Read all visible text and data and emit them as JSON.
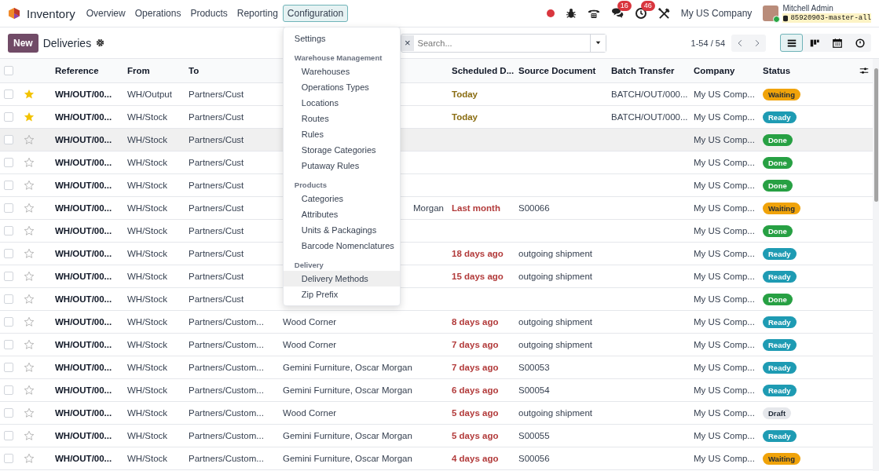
{
  "navbar": {
    "app_name": "Inventory",
    "menu": [
      {
        "label": "Overview",
        "selected": false
      },
      {
        "label": "Operations",
        "selected": false
      },
      {
        "label": "Products",
        "selected": false
      },
      {
        "label": "Reporting",
        "selected": false
      },
      {
        "label": "Configuration",
        "selected": true
      }
    ],
    "systray": {
      "chat_count": "16",
      "activity_count": "46",
      "company": "My US Company",
      "user_name": "Mitchell Admin",
      "database": "85920903-master-all"
    }
  },
  "control_panel": {
    "new_label": "New",
    "title": "Deliveries",
    "search": {
      "facet_remove": "×",
      "placeholder": "Search..."
    },
    "pager": "1-54 / 54",
    "views": [
      {
        "kind": "list",
        "selected": true
      },
      {
        "kind": "kanban",
        "selected": false
      },
      {
        "kind": "calendar",
        "selected": false
      },
      {
        "kind": "activity",
        "selected": false
      }
    ]
  },
  "configuration_menu": {
    "entries": [
      {
        "kind": "item",
        "label": "Settings",
        "highlighted": false
      },
      {
        "kind": "section",
        "label": "Warehouse Management",
        "children": [
          {
            "label": "Warehouses",
            "highlighted": false
          },
          {
            "label": "Operations Types",
            "highlighted": false
          },
          {
            "label": "Locations",
            "highlighted": false
          },
          {
            "label": "Routes",
            "highlighted": false
          },
          {
            "label": "Rules",
            "highlighted": false
          },
          {
            "label": "Storage Categories",
            "highlighted": false
          },
          {
            "label": "Putaway Rules",
            "highlighted": false
          }
        ]
      },
      {
        "kind": "section",
        "label": "Products",
        "children": [
          {
            "label": "Categories",
            "highlighted": false
          },
          {
            "label": "Attributes",
            "highlighted": false
          },
          {
            "label": "Units & Packagings",
            "highlighted": false
          },
          {
            "label": "Barcode Nomenclatures",
            "highlighted": false
          }
        ]
      },
      {
        "kind": "section",
        "label": "Delivery",
        "children": [
          {
            "label": "Delivery Methods",
            "highlighted": true
          },
          {
            "label": "Zip Prefix",
            "highlighted": false
          }
        ]
      }
    ]
  },
  "table": {
    "select_all_checked": false,
    "columns": [
      "Reference",
      "From",
      "To",
      "Scheduled D...",
      "Source Document",
      "Batch Transfer",
      "Company",
      "Status"
    ],
    "rows": [
      {
        "checked": false,
        "starred": true,
        "highlighted": false,
        "reference": "WH/OUT/00...",
        "from": "WH/Output",
        "to": "Partners/Cust",
        "scheduled": {
          "label": "Today",
          "color": "#8a6d12"
        },
        "batch": "BATCH/OUT/000...",
        "company": "My US Comp...",
        "status": {
          "label": "Waiting",
          "color": "#f0a30a"
        }
      },
      {
        "checked": false,
        "starred": true,
        "highlighted": false,
        "reference": "WH/OUT/00...",
        "from": "WH/Stock",
        "to": "Partners/Cust",
        "scheduled": {
          "label": "Today",
          "color": "#8a6d12"
        },
        "batch": "BATCH/OUT/000...",
        "company": "My US Comp...",
        "status": {
          "label": "Ready",
          "color": "#1e9bb3"
        }
      },
      {
        "checked": false,
        "starred": false,
        "highlighted": true,
        "reference": "WH/OUT/00...",
        "from": "WH/Stock",
        "to": "Partners/Cust",
        "company": "My US Comp...",
        "status": {
          "label": "Done",
          "color": "#27a043"
        }
      },
      {
        "checked": false,
        "starred": false,
        "highlighted": false,
        "reference": "WH/OUT/00...",
        "from": "WH/Stock",
        "to": "Partners/Cust",
        "company": "My US Comp...",
        "status": {
          "label": "Done",
          "color": "#27a043"
        }
      },
      {
        "checked": false,
        "starred": false,
        "highlighted": false,
        "reference": "WH/OUT/00...",
        "from": "WH/Stock",
        "to": "Partners/Cust",
        "company": "My US Comp...",
        "status": {
          "label": "Done",
          "color": "#27a043"
        }
      },
      {
        "checked": false,
        "starred": false,
        "highlighted": false,
        "reference": "WH/OUT/00...",
        "from": "WH/Stock",
        "to": "Partners/Cust",
        "column_4": "Morgan",
        "column_4_cut": true,
        "scheduled": {
          "label": "Last month",
          "color": "#b23b3b"
        },
        "source": "S00066",
        "company": "My US Comp...",
        "status": {
          "label": "Waiting",
          "color": "#f0a30a"
        }
      },
      {
        "checked": false,
        "starred": false,
        "highlighted": false,
        "reference": "WH/OUT/00...",
        "from": "WH/Stock",
        "to": "Partners/Cust",
        "company": "My US Comp...",
        "status": {
          "label": "Done",
          "color": "#27a043"
        }
      },
      {
        "checked": false,
        "starred": false,
        "highlighted": false,
        "reference": "WH/OUT/00...",
        "from": "WH/Stock",
        "to": "Partners/Cust",
        "scheduled": {
          "label": "18 days ago",
          "color": "#b23b3b"
        },
        "source": "outgoing shipment",
        "company": "My US Comp...",
        "status": {
          "label": "Ready",
          "color": "#1e9bb3"
        }
      },
      {
        "checked": false,
        "starred": false,
        "highlighted": false,
        "reference": "WH/OUT/00...",
        "from": "WH/Stock",
        "to": "Partners/Cust",
        "scheduled": {
          "label": "15 days ago",
          "color": "#b23b3b"
        },
        "source": "outgoing shipment",
        "company": "My US Comp...",
        "status": {
          "label": "Ready",
          "color": "#1e9bb3"
        }
      },
      {
        "checked": false,
        "starred": false,
        "highlighted": false,
        "reference": "WH/OUT/00...",
        "from": "WH/Stock",
        "to": "Partners/Cust",
        "company": "My US Comp...",
        "status": {
          "label": "Done",
          "color": "#27a043"
        }
      },
      {
        "checked": false,
        "starred": false,
        "highlighted": false,
        "reference": "WH/OUT/00...",
        "from": "WH/Stock",
        "to": "Partners/Custom...",
        "column_4": "Wood Corner",
        "scheduled": {
          "label": "8 days ago",
          "color": "#b23b3b"
        },
        "source": "outgoing shipment",
        "company": "My US Comp...",
        "status": {
          "label": "Ready",
          "color": "#1e9bb3"
        }
      },
      {
        "checked": false,
        "starred": false,
        "highlighted": false,
        "reference": "WH/OUT/00...",
        "from": "WH/Stock",
        "to": "Partners/Custom...",
        "column_4": "Wood Corner",
        "scheduled": {
          "label": "7 days ago",
          "color": "#b23b3b"
        },
        "source": "outgoing shipment",
        "company": "My US Comp...",
        "status": {
          "label": "Ready",
          "color": "#1e9bb3"
        }
      },
      {
        "checked": false,
        "starred": false,
        "highlighted": false,
        "reference": "WH/OUT/00...",
        "from": "WH/Stock",
        "to": "Partners/Custom...",
        "column_4": "Gemini Furniture, Oscar Morgan",
        "scheduled": {
          "label": "7 days ago",
          "color": "#b23b3b"
        },
        "source": "S00053",
        "company": "My US Comp...",
        "status": {
          "label": "Ready",
          "color": "#1e9bb3"
        }
      },
      {
        "checked": false,
        "starred": false,
        "highlighted": false,
        "reference": "WH/OUT/00...",
        "from": "WH/Stock",
        "to": "Partners/Custom...",
        "column_4": "Gemini Furniture, Oscar Morgan",
        "scheduled": {
          "label": "6 days ago",
          "color": "#b23b3b"
        },
        "source": "S00054",
        "company": "My US Comp...",
        "status": {
          "label": "Ready",
          "color": "#1e9bb3"
        }
      },
      {
        "checked": false,
        "starred": false,
        "highlighted": false,
        "reference": "WH/OUT/00...",
        "from": "WH/Stock",
        "to": "Partners/Custom...",
        "column_4": "Wood Corner",
        "scheduled": {
          "label": "5 days ago",
          "color": "#b23b3b"
        },
        "source": "outgoing shipment",
        "company": "My US Comp...",
        "status": {
          "label": "Draft",
          "color": "#e5e7eb"
        }
      },
      {
        "checked": false,
        "starred": false,
        "highlighted": false,
        "reference": "WH/OUT/00...",
        "from": "WH/Stock",
        "to": "Partners/Custom...",
        "column_4": "Gemini Furniture, Oscar Morgan",
        "scheduled": {
          "label": "5 days ago",
          "color": "#b23b3b"
        },
        "source": "S00055",
        "company": "My US Comp...",
        "status": {
          "label": "Ready",
          "color": "#1e9bb3"
        }
      },
      {
        "checked": false,
        "starred": false,
        "highlighted": false,
        "reference": "WH/OUT/00...",
        "from": "WH/Stock",
        "to": "Partners/Custom...",
        "column_4": "Gemini Furniture, Oscar Morgan",
        "scheduled": {
          "label": "4 days ago",
          "color": "#b23b3b"
        },
        "source": "S00056",
        "company": "My US Comp...",
        "status": {
          "label": "Waiting",
          "color": "#f0a30a"
        }
      }
    ]
  }
}
